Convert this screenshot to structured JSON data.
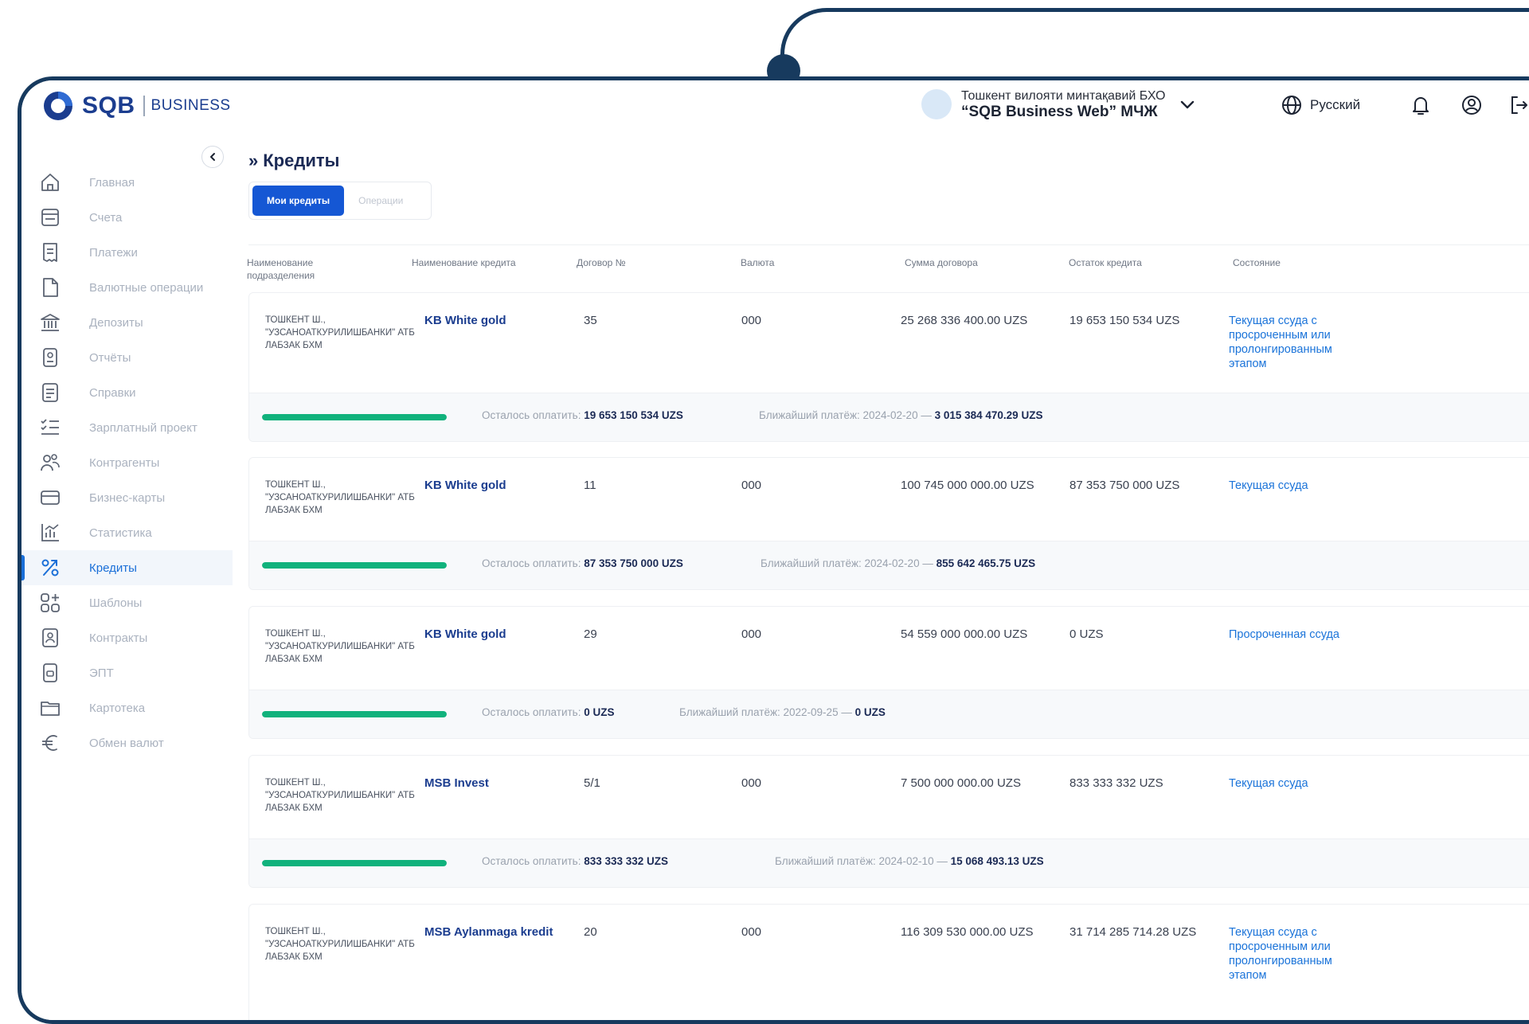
{
  "header": {
    "logo_text": "SQB",
    "logo_sub": "BUSINESS",
    "org_line1": "Тошкент вилояти минтақавий БХО",
    "org_line2": "“SQB Business Web” МЧЖ",
    "language": "Русский",
    "icons": [
      "chevron-down-icon",
      "globe-icon",
      "bell-icon",
      "user-circle-icon",
      "logout-icon"
    ]
  },
  "sidebar": {
    "items": [
      {
        "label": "Главная",
        "icon": "home-icon"
      },
      {
        "label": "Счета",
        "icon": "accounts-icon"
      },
      {
        "label": "Платежи",
        "icon": "payments-icon"
      },
      {
        "label": "Валютные операции",
        "icon": "document-icon"
      },
      {
        "label": "Депозиты",
        "icon": "bank-icon"
      },
      {
        "label": "Отчёты",
        "icon": "reports-icon"
      },
      {
        "label": "Справки",
        "icon": "certificate-icon"
      },
      {
        "label": "Зарплатный проект",
        "icon": "checklist-icon"
      },
      {
        "label": "Контрагенты",
        "icon": "contacts-icon"
      },
      {
        "label": "Бизнес-карты",
        "icon": "card-icon"
      },
      {
        "label": "Статистика",
        "icon": "statistics-icon"
      },
      {
        "label": "Кредиты",
        "icon": "percent-icon",
        "active": true
      },
      {
        "label": "Шаблоны",
        "icon": "templates-icon"
      },
      {
        "label": "Контракты",
        "icon": "contracts-icon"
      },
      {
        "label": "ЭПТ",
        "icon": "ept-icon"
      },
      {
        "label": "Картотека",
        "icon": "folder-icon"
      },
      {
        "label": "Обмен валют",
        "icon": "euro-icon"
      }
    ]
  },
  "main": {
    "title": "Кредиты",
    "tabs": [
      {
        "label": "Мои кредиты",
        "active": true
      },
      {
        "label": "Операции",
        "active": false
      }
    ],
    "columns": [
      "Наименование подразделения",
      "Наименование кредита",
      "Договор №",
      "Валюта",
      "Сумма договора",
      "Остаток кредита",
      "Состояние"
    ],
    "pay_left_label": "Осталось оплатить:",
    "pay_next_label": "Ближайший платёж:",
    "loans": [
      {
        "dept": "ТОШКЕНТ Ш., \"УЗСАНОАТКУРИЛИШБАНКИ\" АТБ ЛАБЗАК БХМ",
        "name": "KB White gold",
        "contract": "35",
        "currency": "000",
        "amount": "25 268 336 400.00 UZS",
        "remaining": "19 653 150 534 UZS",
        "status": "Текущая ссуда с просроченным или пролонгированным этапом",
        "left_to_pay": "19 653 150 534 UZS",
        "next_date": "2024-02-20 —",
        "next_amount": "3 015 384 470.29 UZS",
        "progress": 1.0
      },
      {
        "dept": "ТОШКЕНТ Ш., \"УЗСАНОАТКУРИЛИШБАНКИ\" АТБ ЛАБЗАК БХМ",
        "name": "KB White gold",
        "contract": "11",
        "currency": "000",
        "amount": "100 745 000 000.00 UZS",
        "remaining": "87 353 750 000 UZS",
        "status": "Текущая ссуда",
        "left_to_pay": "87 353 750 000 UZS",
        "next_date": "2024-02-20 —",
        "next_amount": "855 642 465.75 UZS",
        "progress": 1.0
      },
      {
        "dept": "ТОШКЕНТ Ш., \"УЗСАНОАТКУРИЛИШБАНКИ\" АТБ ЛАБЗАК БХМ",
        "name": "KB White gold",
        "contract": "29",
        "currency": "000",
        "amount": "54 559 000 000.00 UZS",
        "remaining": "0 UZS",
        "status": "Просроченная ссуда",
        "left_to_pay": "0 UZS",
        "next_date": "2022-09-25 —",
        "next_amount": "0 UZS",
        "progress": 1.0
      },
      {
        "dept": "ТОШКЕНТ Ш., \"УЗСАНОАТКУРИЛИШБАНКИ\" АТБ ЛАБЗАК БХМ",
        "name": "MSB Invest",
        "contract": "5/1",
        "currency": "000",
        "amount": "7 500 000 000.00 UZS",
        "remaining": "833 333 332 UZS",
        "status": "Текущая ссуда",
        "left_to_pay": "833 333 332 UZS",
        "next_date": "2024-02-10 —",
        "next_amount": "15 068 493.13 UZS",
        "progress": 1.0
      },
      {
        "dept": "ТОШКЕНТ Ш., \"УЗСАНОАТКУРИЛИШБАНКИ\" АТБ ЛАБЗАК БХМ",
        "name": "MSB Aylanmaga kredit",
        "contract": "20",
        "currency": "000",
        "amount": "116 309 530 000.00 UZS",
        "remaining": "31 714 285 714.28 UZS",
        "status": "Текущая ссуда с просроченным или пролонгированным этапом"
      }
    ]
  },
  "colors": {
    "frame": "#173a5e",
    "brand": "#1b3d8f",
    "accent": "#1557d4",
    "link": "#1a73d9",
    "progress": "#10b27c"
  }
}
